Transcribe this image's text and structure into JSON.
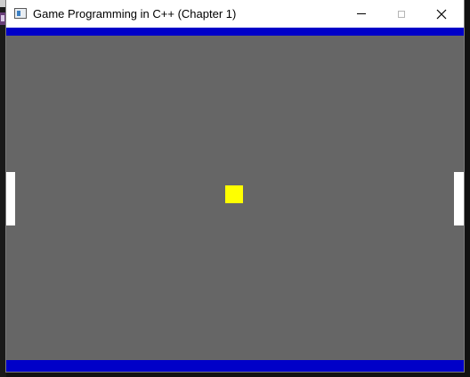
{
  "window": {
    "title": "Game Programming in C++ (Chapter 1)",
    "icon": "app-window-icon",
    "controls": {
      "minimize_icon": "minimize-icon",
      "maximize_icon": "maximize-icon",
      "close_icon": "close-icon"
    }
  },
  "game": {
    "name": "pong",
    "background_color": "#666666",
    "wall_color": "#0000c8",
    "paddle_color": "#ffffff",
    "ball_color": "#ffff00"
  }
}
